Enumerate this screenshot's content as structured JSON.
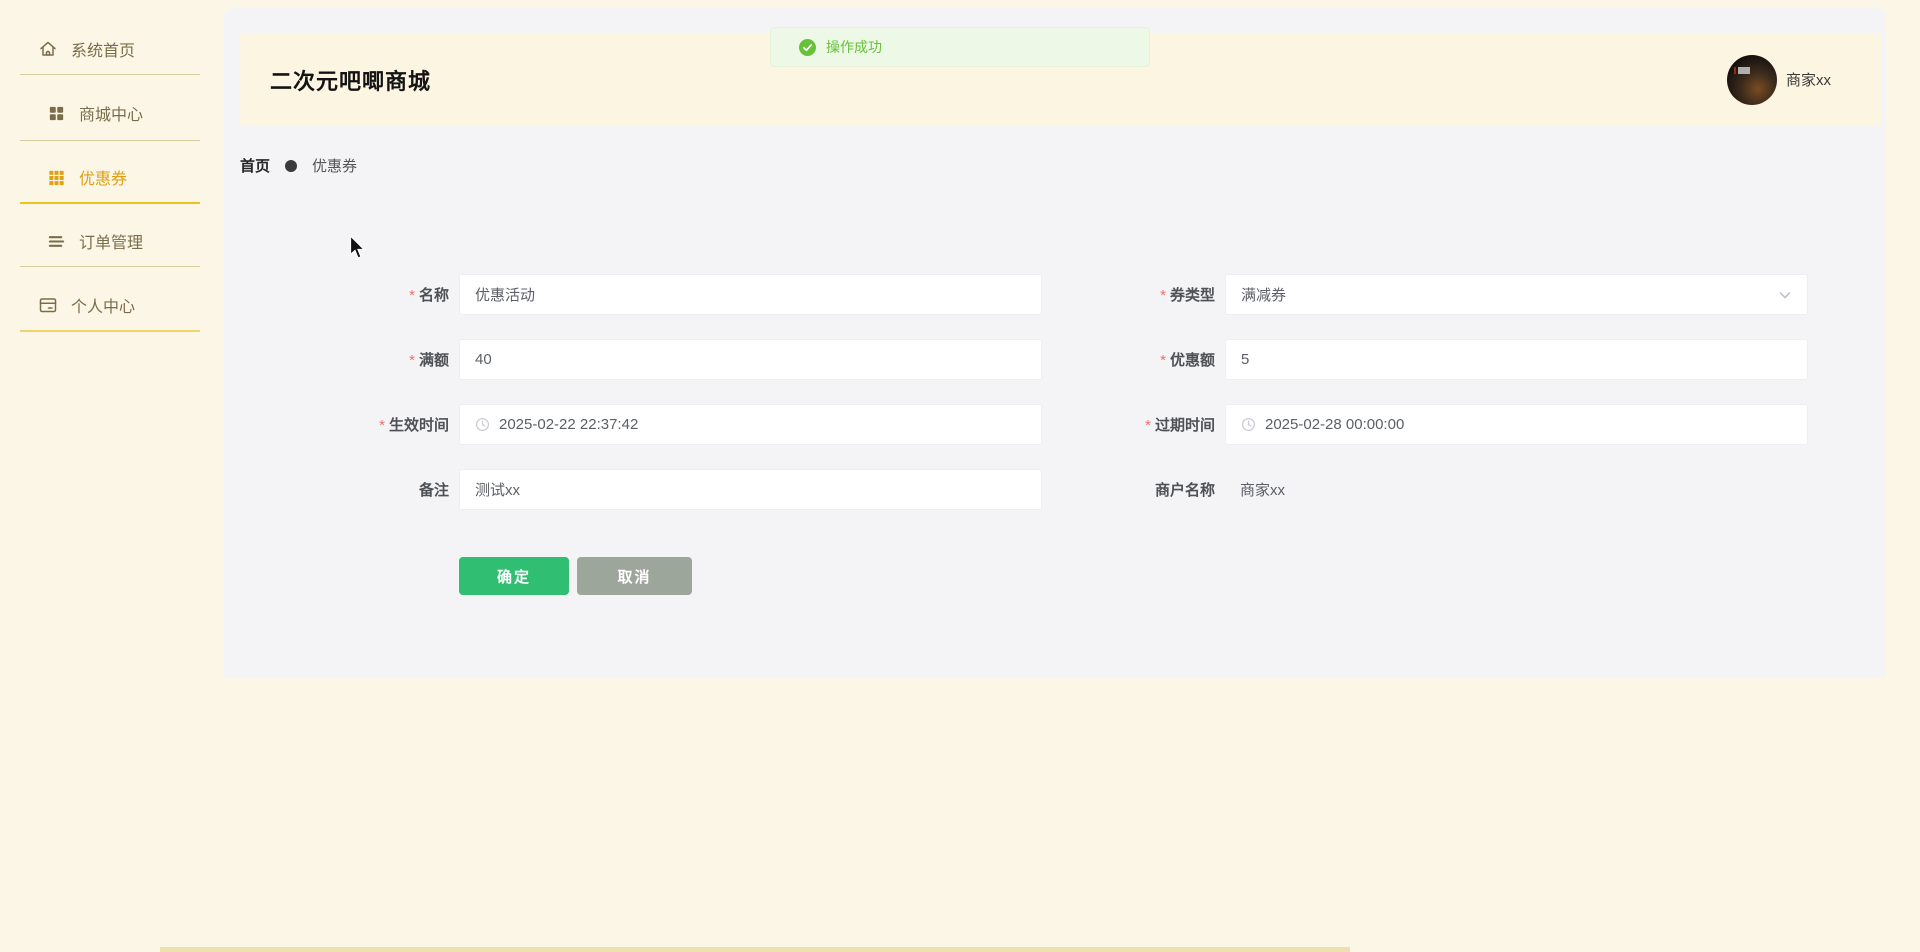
{
  "app": {
    "title": "二次元吧唧商城",
    "user": {
      "name": "商家xx",
      "avatar_icon": "user-avatar-photo"
    }
  },
  "toast": {
    "text": "操作成功",
    "icon": "check-circle-icon"
  },
  "sidebar": {
    "items": [
      {
        "label": "系统首页",
        "icon": "home-icon",
        "active": false
      },
      {
        "label": "商城中心",
        "icon": "grid-icon",
        "active": false
      },
      {
        "label": "优惠券",
        "icon": "coupon-grid-icon",
        "active": true
      },
      {
        "label": "订单管理",
        "icon": "list-icon",
        "active": false
      },
      {
        "label": "个人中心",
        "icon": "card-icon",
        "active": false
      }
    ]
  },
  "breadcrumb": {
    "home": "首页",
    "current": "优惠券"
  },
  "form": {
    "required_marker": "*",
    "fields": {
      "name": {
        "label": "名称",
        "required": true,
        "value": "优惠活动"
      },
      "coupon_type": {
        "label": "券类型",
        "required": true,
        "value": "满减券",
        "control": "select",
        "icon": "chevron-down-icon"
      },
      "threshold": {
        "label": "满额",
        "required": true,
        "value": "40"
      },
      "discount": {
        "label": "优惠额",
        "required": true,
        "value": "5"
      },
      "effective_time": {
        "label": "生效时间",
        "required": true,
        "value": "2025-02-22 22:37:42",
        "control": "datetime",
        "icon": "clock-icon"
      },
      "expire_time": {
        "label": "过期时间",
        "required": true,
        "value": "2025-02-28 00:00:00",
        "control": "datetime",
        "icon": "clock-icon"
      },
      "remark": {
        "label": "备注",
        "required": false,
        "value": "测试xx"
      },
      "merchant": {
        "label": "商户名称",
        "required": false,
        "value": "商家xx",
        "control": "static-text"
      }
    },
    "buttons": {
      "confirm": "确定",
      "cancel": "取消"
    }
  },
  "theme": {
    "page_cream": "#FCF6E6",
    "panel_gray": "#F4F4F7",
    "accent_gold": "#DFA014",
    "active_underline_gold": "#EFC41A",
    "primary_green": "#30BE72",
    "cancel_gray": "#9DA69B",
    "toast_success_green": "#67C23A",
    "required_red": "#F56C6C"
  }
}
